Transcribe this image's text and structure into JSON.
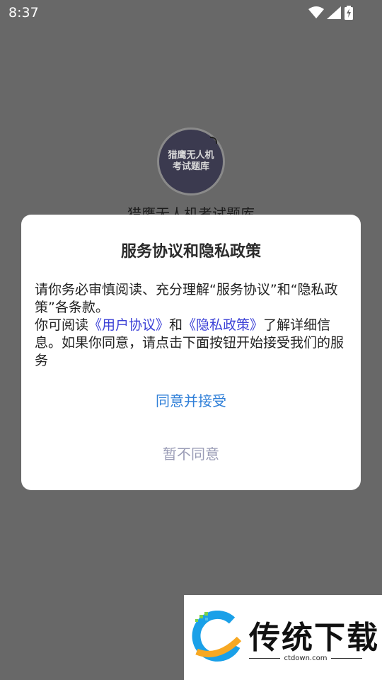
{
  "status_bar": {
    "time": "8:37",
    "icons": [
      "wifi-icon",
      "signal-icon",
      "battery-charging-icon"
    ]
  },
  "splash": {
    "logo_line1": "猎鹰无人机",
    "logo_line2": "考试题库",
    "app_name": "猎鹰无人机考试题库"
  },
  "dialog": {
    "title": "服务协议和隐私政策",
    "intro": "请你务必审慎阅读、充分理解“服务协议”和“隐私政策”各条款。",
    "read_prefix": "你可阅读",
    "user_agreement_link": "《用户协议》",
    "and": "和",
    "privacy_policy_link": "《隐私政策》",
    "read_suffix": "了解详细信息。如果你同意，请点击下面按钮开始接受我们的服务",
    "accept_label": "同意并接受",
    "decline_label": "暂不同意"
  },
  "watermark": {
    "title": "传统下载",
    "domain": "ctdown.com"
  },
  "colors": {
    "overlay": "#686868",
    "link": "#3a3fd6",
    "accept": "#2f7fd8",
    "decline": "#9a9cb6"
  }
}
